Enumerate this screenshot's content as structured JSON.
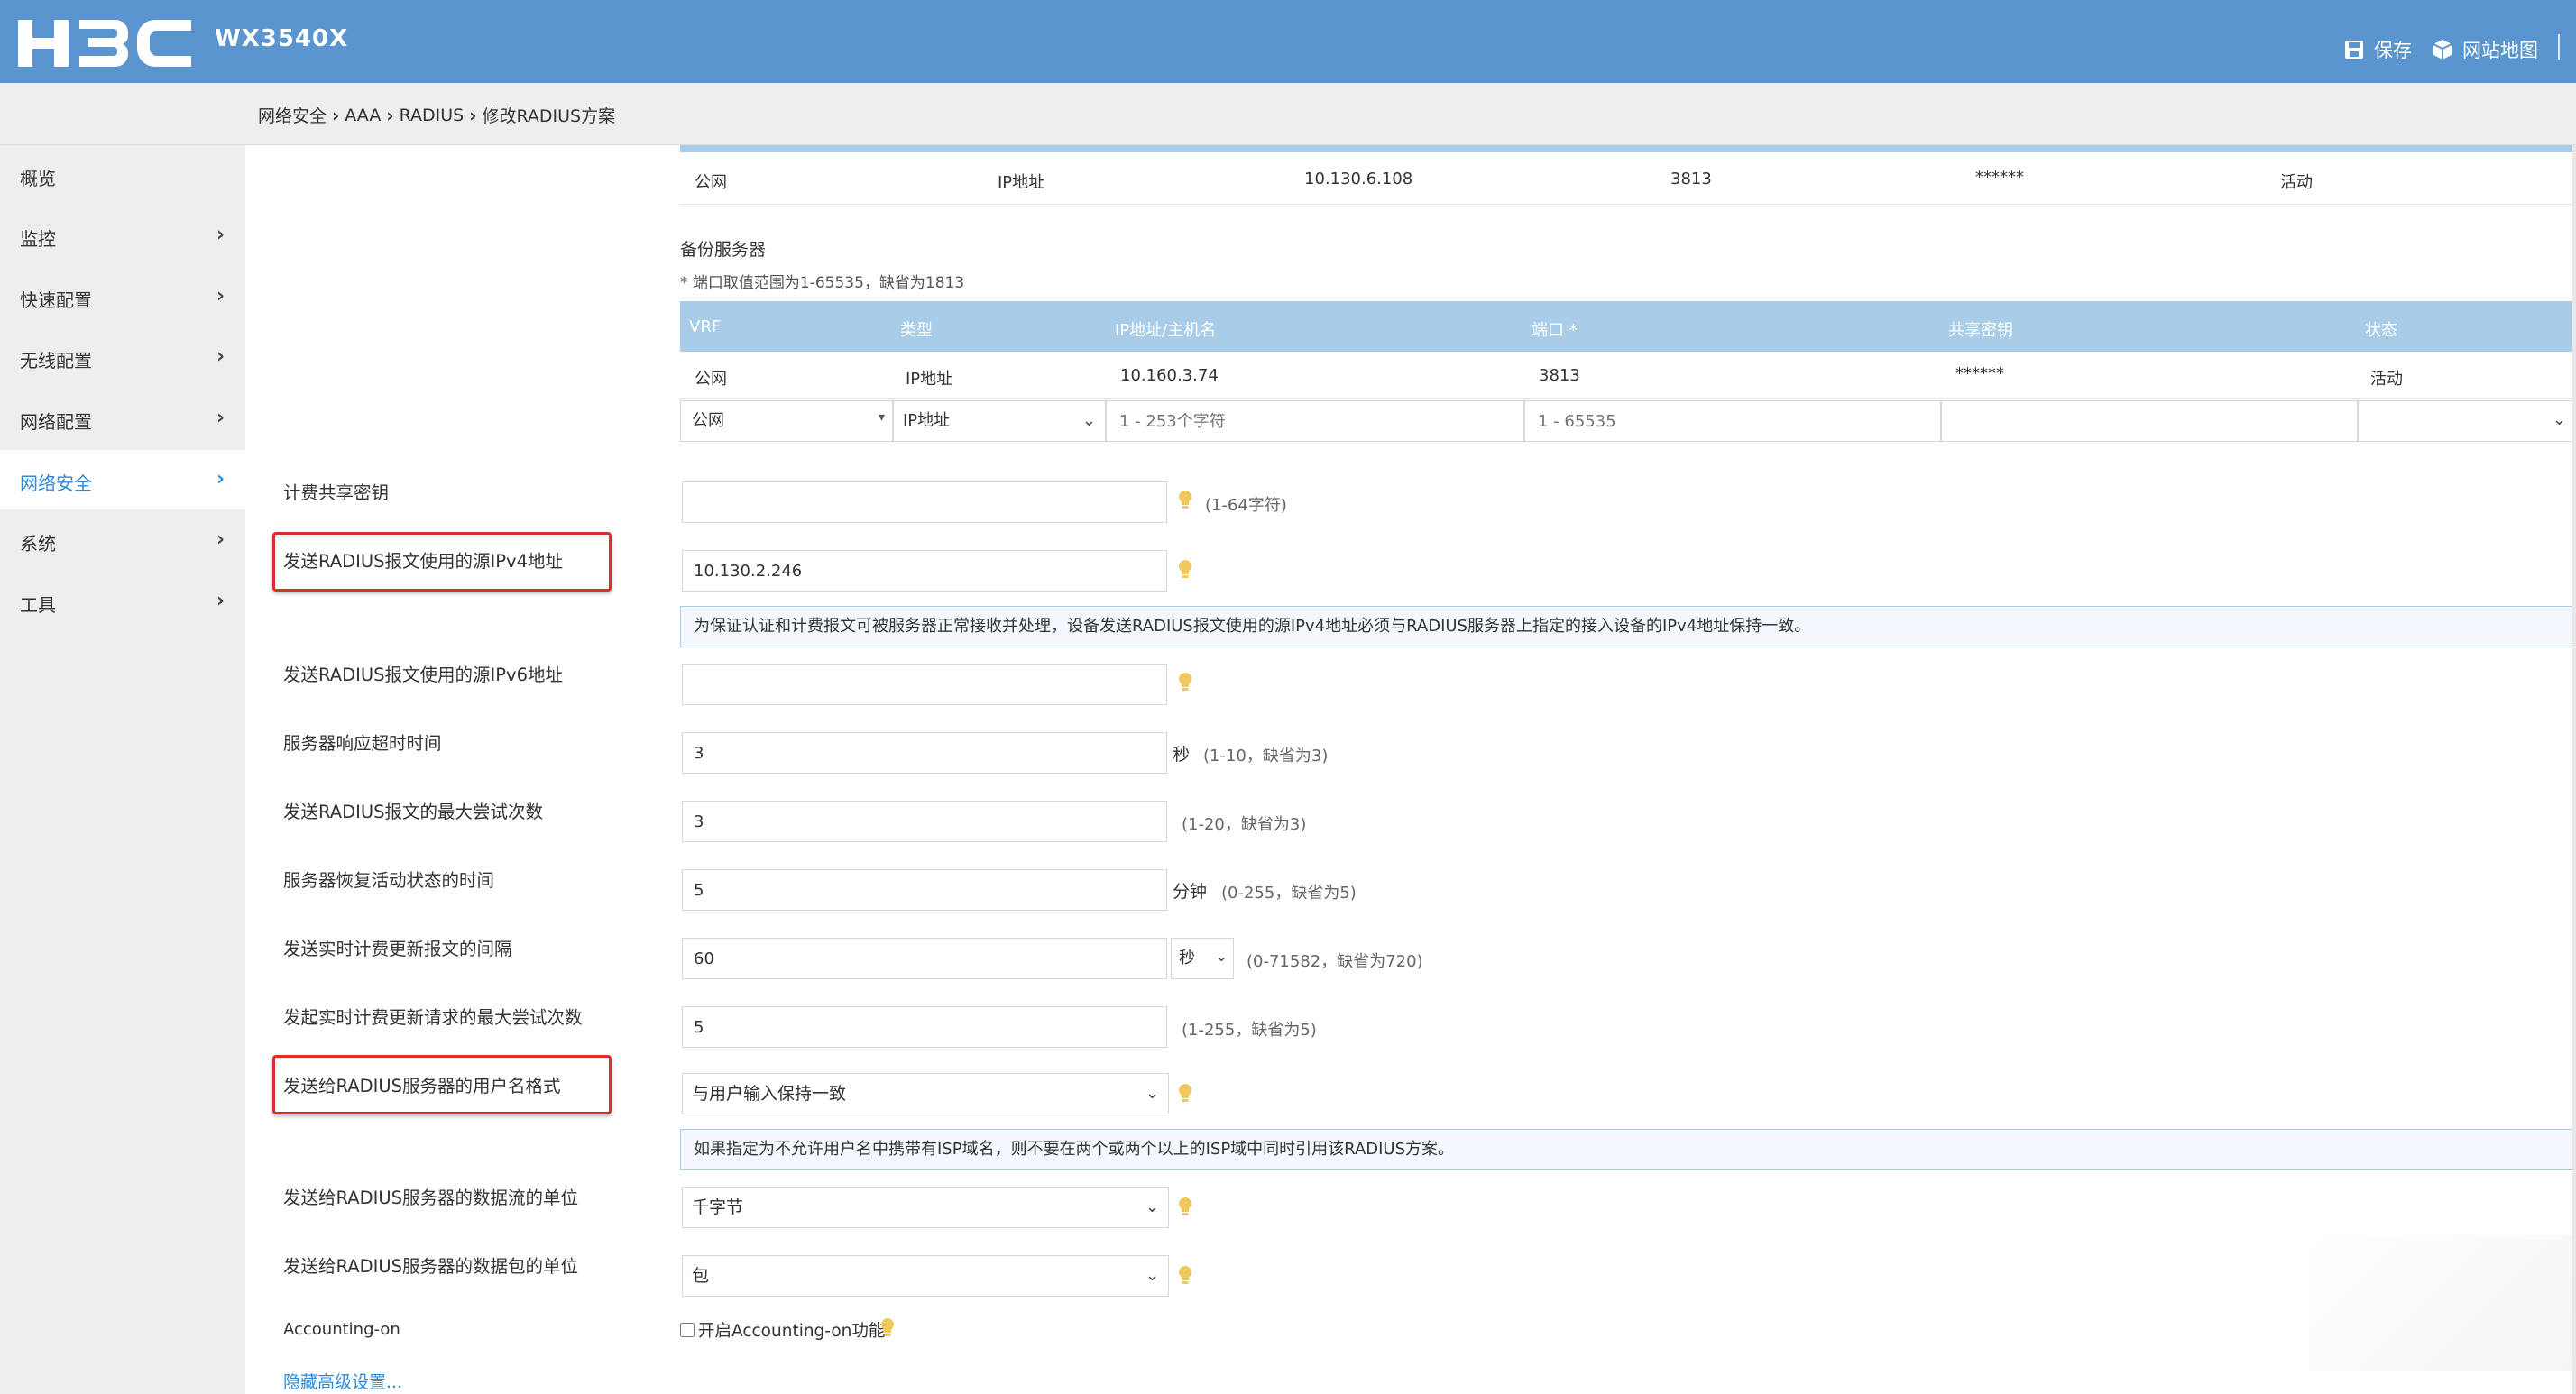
{
  "app": {
    "brand": "H3C",
    "model": "WX3540X",
    "save_label": "保存",
    "sitemap_label": "网站地图"
  },
  "breadcrumb": [
    "网络安全",
    "AAA",
    "RADIUS",
    "修改RADIUS方案"
  ],
  "sidebar": {
    "items": [
      {
        "label": "概览",
        "has_submenu": false
      },
      {
        "label": "监控",
        "has_submenu": true
      },
      {
        "label": "快速配置",
        "has_submenu": true
      },
      {
        "label": "无线配置",
        "has_submenu": true
      },
      {
        "label": "网络配置",
        "has_submenu": true
      },
      {
        "label": "网络安全",
        "has_submenu": true,
        "active": true
      },
      {
        "label": "系统",
        "has_submenu": true
      },
      {
        "label": "工具",
        "has_submenu": true
      }
    ]
  },
  "primary_server_row": {
    "vrf": "公网",
    "type": "IP地址",
    "address": "10.130.6.108",
    "port": "3813",
    "key": "******",
    "status": "活动"
  },
  "backup": {
    "title": "备份服务器",
    "port_note": "* 端口取值范围为1-65535，缺省为1813",
    "headers": [
      "VRF",
      "类型",
      "IP地址/主机名",
      "端口 *",
      "共享密钥",
      "状态"
    ],
    "row": {
      "vrf": "公网",
      "type": "IP地址",
      "address": "10.160.3.74",
      "port": "3813",
      "key": "******",
      "status": "活动"
    },
    "new_row": {
      "vrf": "公网",
      "type": "IP地址",
      "address_placeholder": "1 - 253个字符",
      "port_placeholder": "1 - 65535"
    }
  },
  "form": {
    "accounting_key": {
      "label": "计费共享密钥",
      "value": "",
      "hint": "(1-64字符)"
    },
    "src_ipv4": {
      "label": "发送RADIUS报文使用的源IPv4地址",
      "value": "10.130.2.246"
    },
    "src_ipv4_notice": "为保证认证和计费报文可被服务器正常接收并处理，设备发送RADIUS报文使用的源IPv4地址必须与RADIUS服务器上指定的接入设备的IPv4地址保持一致。",
    "src_ipv6": {
      "label": "发送RADIUS报文使用的源IPv6地址",
      "value": ""
    },
    "timeout": {
      "label": "服务器响应超时时间",
      "value": "3",
      "unit": "秒",
      "hint": "(1-10，缺省为3)"
    },
    "retries": {
      "label": "发送RADIUS报文的最大尝试次数",
      "value": "3",
      "hint": "(1-20，缺省为3)"
    },
    "quiet_time": {
      "label": "服务器恢复活动状态的时间",
      "value": "5",
      "unit": "分钟",
      "hint": "(0-255，缺省为5)"
    },
    "realtime_interval": {
      "label": "发送实时计费更新报文的间隔",
      "value": "60",
      "unit_select": "秒",
      "hint": "(0-71582，缺省为720)"
    },
    "realtime_retries": {
      "label": "发起实时计费更新请求的最大尝试次数",
      "value": "5",
      "hint": "(1-255，缺省为5)"
    },
    "username_format": {
      "label": "发送给RADIUS服务器的用户名格式",
      "value": "与用户输入保持一致"
    },
    "username_notice": "如果指定为不允许用户名中携带有ISP域名，则不要在两个或两个以上的ISP域中同时引用该RADIUS方案。",
    "data_flow_unit": {
      "label": "发送给RADIUS服务器的数据流的单位",
      "value": "千字节"
    },
    "packet_unit": {
      "label": "发送给RADIUS服务器的数据包的单位",
      "value": "包"
    },
    "accounting_on": {
      "label": "Accounting-on",
      "checkbox_label": "开启Accounting-on功能",
      "checked": false
    },
    "hide_advanced": "隐藏高级设置..."
  },
  "colors": {
    "header_bg": "#5b95cf",
    "table_header_bg": "#a9cde8",
    "active_nav": "#2f8bd8",
    "highlight_border": "#d9302a",
    "bulb": "#f2c75c"
  }
}
